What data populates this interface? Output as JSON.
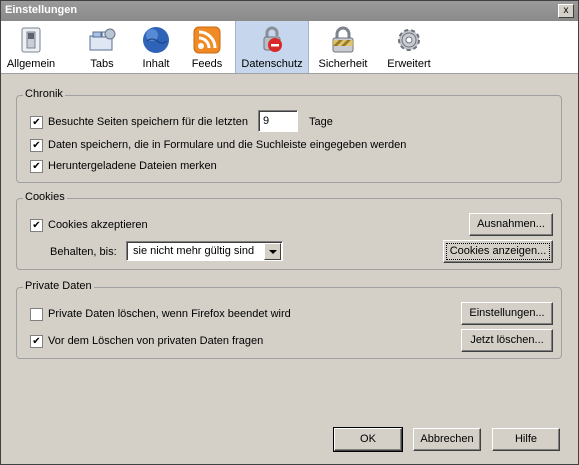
{
  "window": {
    "title": "Einstellungen",
    "close_symbol": "x"
  },
  "toolbar": {
    "items": [
      {
        "label": "Allgemein",
        "icon": "switch-icon"
      },
      {
        "label": "Tabs",
        "icon": "tabs-icon"
      },
      {
        "label": "Inhalt",
        "icon": "globe-icon"
      },
      {
        "label": "Feeds",
        "icon": "rss-icon"
      },
      {
        "label": "Datenschutz",
        "icon": "lock-sign-icon",
        "active": true
      },
      {
        "label": "Sicherheit",
        "icon": "padlock-icon"
      },
      {
        "label": "Erweitert",
        "icon": "gear-icon"
      }
    ]
  },
  "chronik": {
    "legend": "Chronik",
    "history_label": "Besuchte Seiten speichern für die letzten",
    "history_days": "9",
    "history_unit": "Tage",
    "history_checked": true,
    "forms_label": "Daten speichern, die in Formulare und die Suchleiste eingegeben werden",
    "forms_checked": true,
    "downloads_label": "Heruntergeladene Dateien merken",
    "downloads_checked": true
  },
  "cookies": {
    "legend": "Cookies",
    "accept_label": "Cookies akzeptieren",
    "accept_checked": true,
    "keep_label": "Behalten, bis:",
    "keep_value": "sie nicht mehr gültig sind",
    "exceptions_button": "Ausnahmen...",
    "show_button": "Cookies anzeigen..."
  },
  "private": {
    "legend": "Private Daten",
    "clear_on_exit_label": "Private Daten löschen, wenn Firefox beendet wird",
    "clear_on_exit_checked": false,
    "ask_label": "Vor dem Löschen von privaten Daten fragen",
    "ask_checked": true,
    "settings_button": "Einstellungen...",
    "clear_now_button": "Jetzt löschen..."
  },
  "footer": {
    "ok": "OK",
    "cancel": "Abbrechen",
    "help": "Hilfe"
  },
  "colors": {
    "titlebar": "#8a8a8a",
    "dialog": "#d4d0c8",
    "toolbar_active": "#c6d6ec"
  }
}
